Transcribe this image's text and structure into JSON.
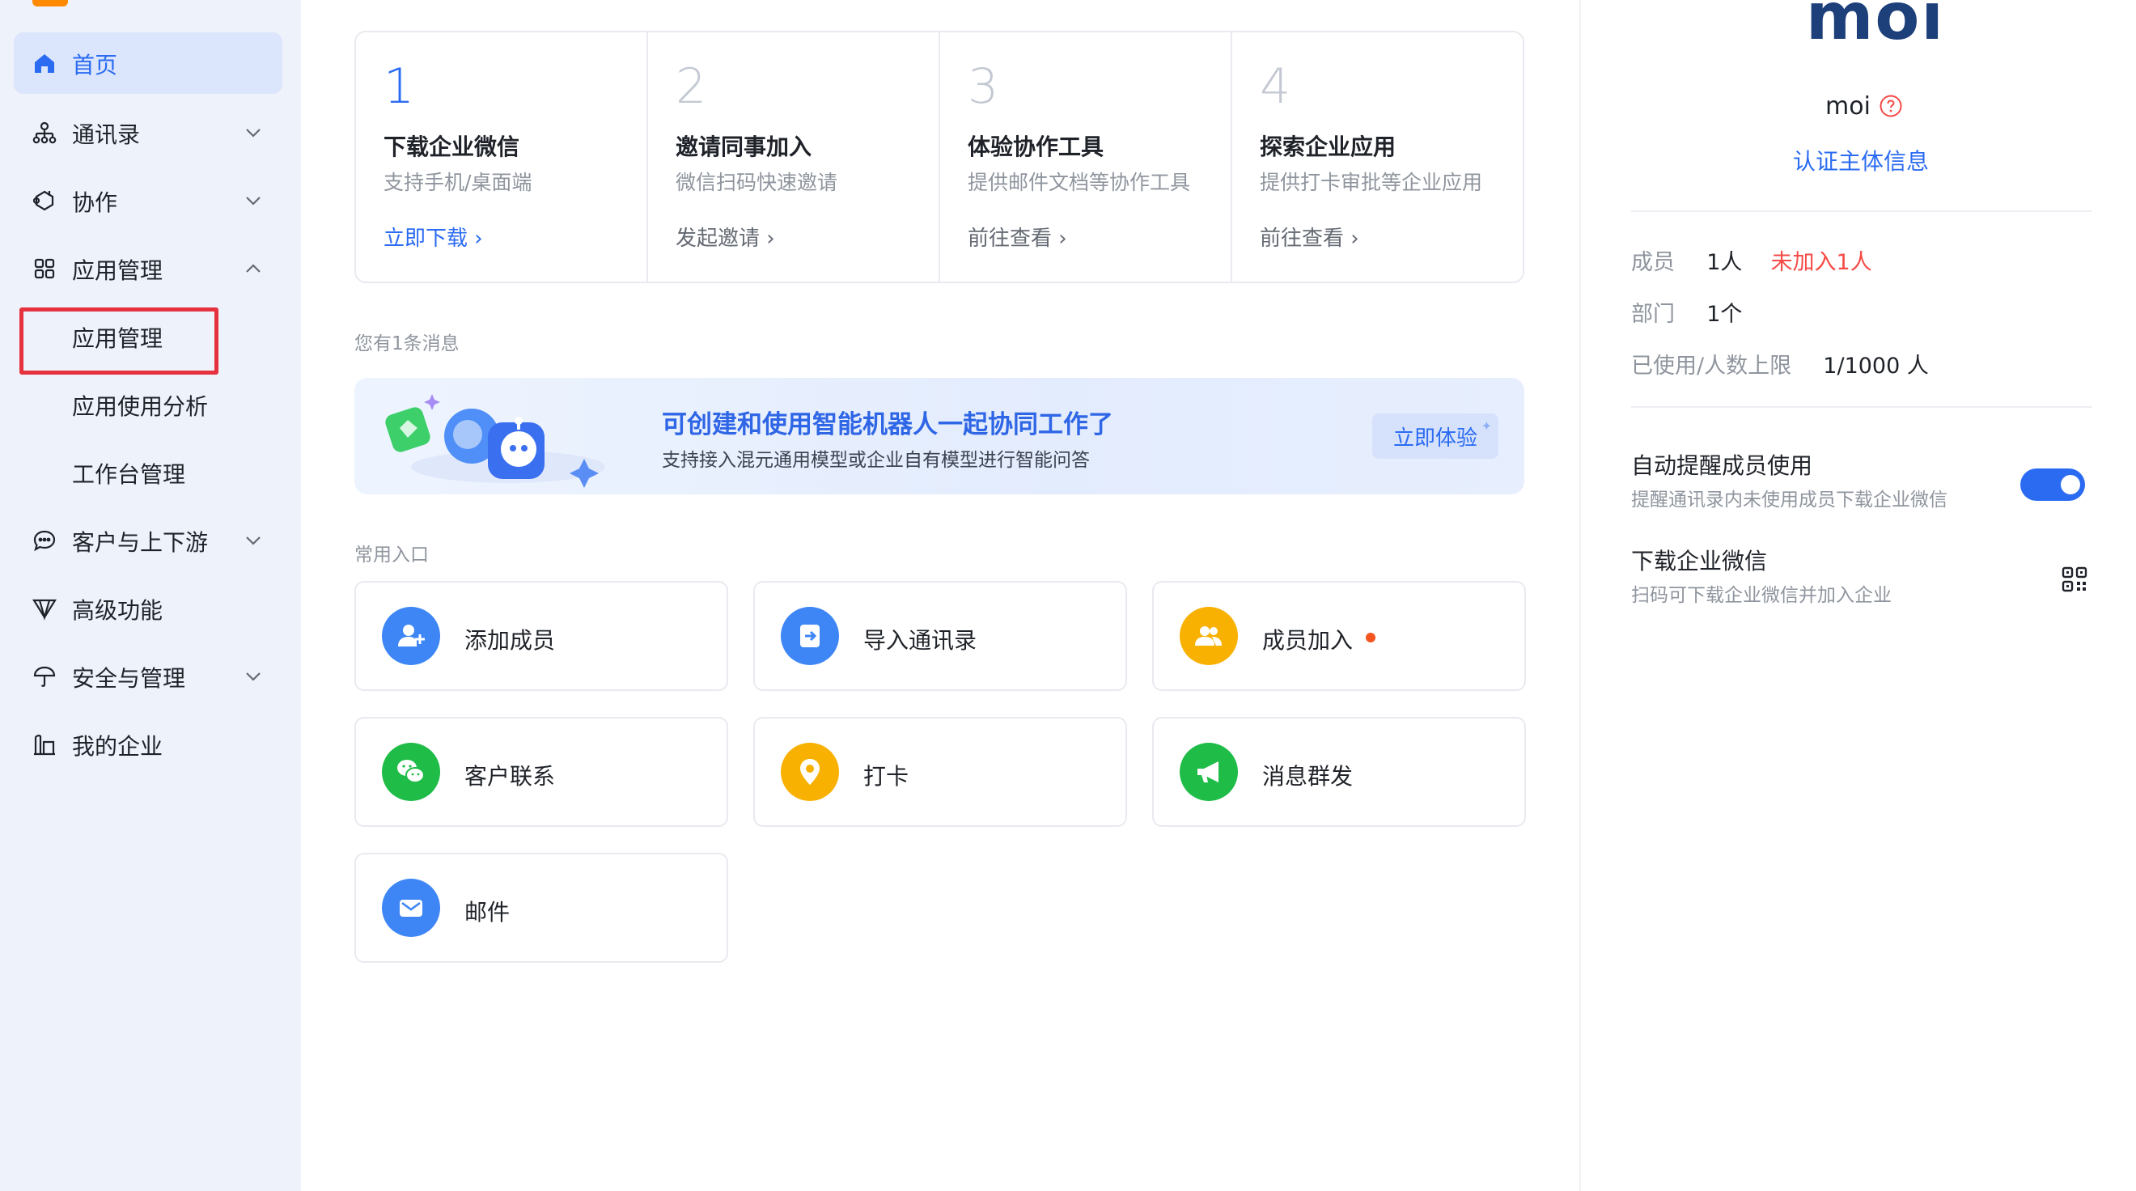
{
  "colors": {
    "accent": "#2a6bf2",
    "sidebar_bg": "#eef2fb",
    "warning": "#f54a45",
    "highlight_box": "#e5323e"
  },
  "sidebar": {
    "items": [
      {
        "label": "首页",
        "icon": "home-icon",
        "active": true
      },
      {
        "label": "通讯录",
        "icon": "org-chart-icon",
        "chevron": "down"
      },
      {
        "label": "协作",
        "icon": "collaborate-icon",
        "chevron": "down"
      },
      {
        "label": "应用管理",
        "icon": "apps-grid-icon",
        "chevron": "up"
      },
      {
        "label": "客户与上下游",
        "icon": "chat-bubble-icon",
        "chevron": "down"
      },
      {
        "label": "高级功能",
        "icon": "diamond-icon"
      },
      {
        "label": "安全与管理",
        "icon": "umbrella-icon",
        "chevron": "down"
      },
      {
        "label": "我的企业",
        "icon": "buildings-icon"
      }
    ],
    "subitems": [
      {
        "label": "应用管理",
        "highlighted": true
      },
      {
        "label": "应用使用分析"
      },
      {
        "label": "工作台管理"
      }
    ]
  },
  "steps": [
    {
      "number": "1",
      "title": "下载企业微信",
      "desc": "支持手机/桌面端",
      "link": "立即下载"
    },
    {
      "number": "2",
      "title": "邀请同事加入",
      "desc": "微信扫码快速邀请",
      "link": "发起邀请"
    },
    {
      "number": "3",
      "title": "体验协作工具",
      "desc": "提供邮件文档等协作工具",
      "link": "前往查看"
    },
    {
      "number": "4",
      "title": "探索企业应用",
      "desc": "提供打卡审批等企业应用",
      "link": "前往查看"
    }
  ],
  "messages": {
    "label": "您有1条消息",
    "banner_title": "可创建和使用智能机器人一起协同工作了",
    "banner_sub": "支持接入混元通用模型或企业自有模型进行智能问答",
    "banner_button": "立即体验",
    "banner_spark": "✦"
  },
  "entries": {
    "label": "常用入口",
    "items": [
      {
        "label": "添加成员",
        "icon": "add-member-icon",
        "color": "#3e86f5"
      },
      {
        "label": "导入通讯录",
        "icon": "import-contacts-icon",
        "color": "#3e86f5"
      },
      {
        "label": "成员加入",
        "icon": "member-join-icon",
        "color": "#f8b100",
        "dot": true
      },
      {
        "label": "客户联系",
        "icon": "wechat-icon",
        "color": "#1fbc48"
      },
      {
        "label": "打卡",
        "icon": "location-pin-icon",
        "color": "#f8b100"
      },
      {
        "label": "消息群发",
        "icon": "megaphone-icon",
        "color": "#1fbc48"
      },
      {
        "label": "邮件",
        "icon": "mail-icon",
        "color": "#3e86f5"
      }
    ]
  },
  "org": {
    "logo_text": "moi",
    "name": "moi",
    "verify_link": "认证主体信息",
    "stats": {
      "members_key": "成员",
      "members_val": "1人",
      "members_unjoined": "未加入1人",
      "depts_key": "部门",
      "depts_val": "1个",
      "limit_key": "已使用/人数上限",
      "limit_val": "1/1000 人"
    },
    "settings": {
      "auto_remind_title": "自动提醒成员使用",
      "auto_remind_desc": "提醒通讯录内未使用成员下载企业微信",
      "auto_remind_on": true,
      "download_title": "下载企业微信",
      "download_desc": "扫码可下载企业微信并加入企业"
    }
  }
}
